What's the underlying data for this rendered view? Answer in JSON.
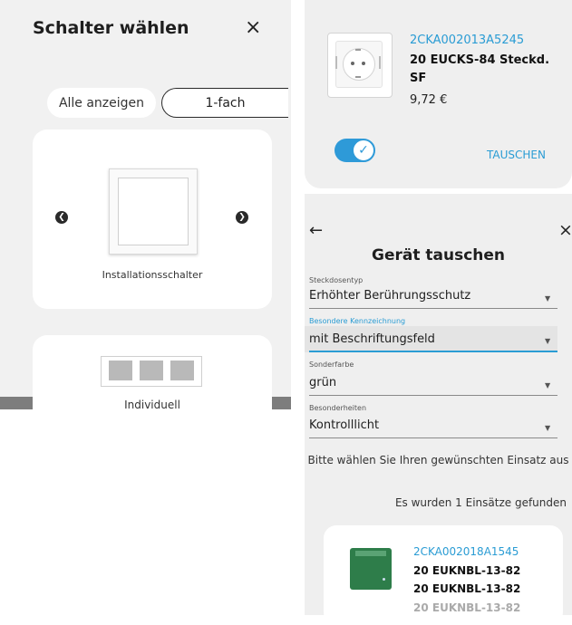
{
  "left_panel": {
    "title": "Schalter wählen",
    "close_glyph": "×",
    "filters": [
      "Alle anzeigen",
      "1-fach"
    ],
    "cards": [
      {
        "label": "Installationsschalter",
        "prev_glyph": "❮",
        "next_glyph": "❯"
      },
      {
        "label": "Individuell"
      }
    ]
  },
  "current_device": {
    "article_no": "2CKA002013A5245",
    "name": "20 EUCKS-84 Steckd. SF",
    "price": "9,72 €",
    "toggle_checked": true,
    "toggle_glyph": "✓",
    "action": "TAUSCHEN"
  },
  "dialog": {
    "back_glyph": "←",
    "close_glyph": "×",
    "title": "Gerät tauschen",
    "fields": [
      {
        "label": "Steckdosentyp",
        "value": "Erhöhter Berührungsschutz"
      },
      {
        "label": "Besondere Kennzeichnung",
        "value": "mit Beschriftungsfeld"
      },
      {
        "label": "Sonderfarbe",
        "value": "grün"
      },
      {
        "label": "Besonderheiten",
        "value": "Kontrolllicht"
      }
    ],
    "caret_glyph": "▼",
    "hint": "Bitte wählen Sie Ihren gewünschten Einsatz aus",
    "found": "Es wurden 1 Einsätze gefunden",
    "result": {
      "article_no": "2CKA002018A1545",
      "name_line1": "20 EUKNBL-13-82",
      "name_line2": "20 EUKNBL-13-82",
      "name_line3": "20 EUKNBL-13-82"
    }
  },
  "colors": {
    "accent": "#2a9cd4",
    "toggle": "#2e9ad8",
    "insert_green": "#2e7d4a"
  }
}
